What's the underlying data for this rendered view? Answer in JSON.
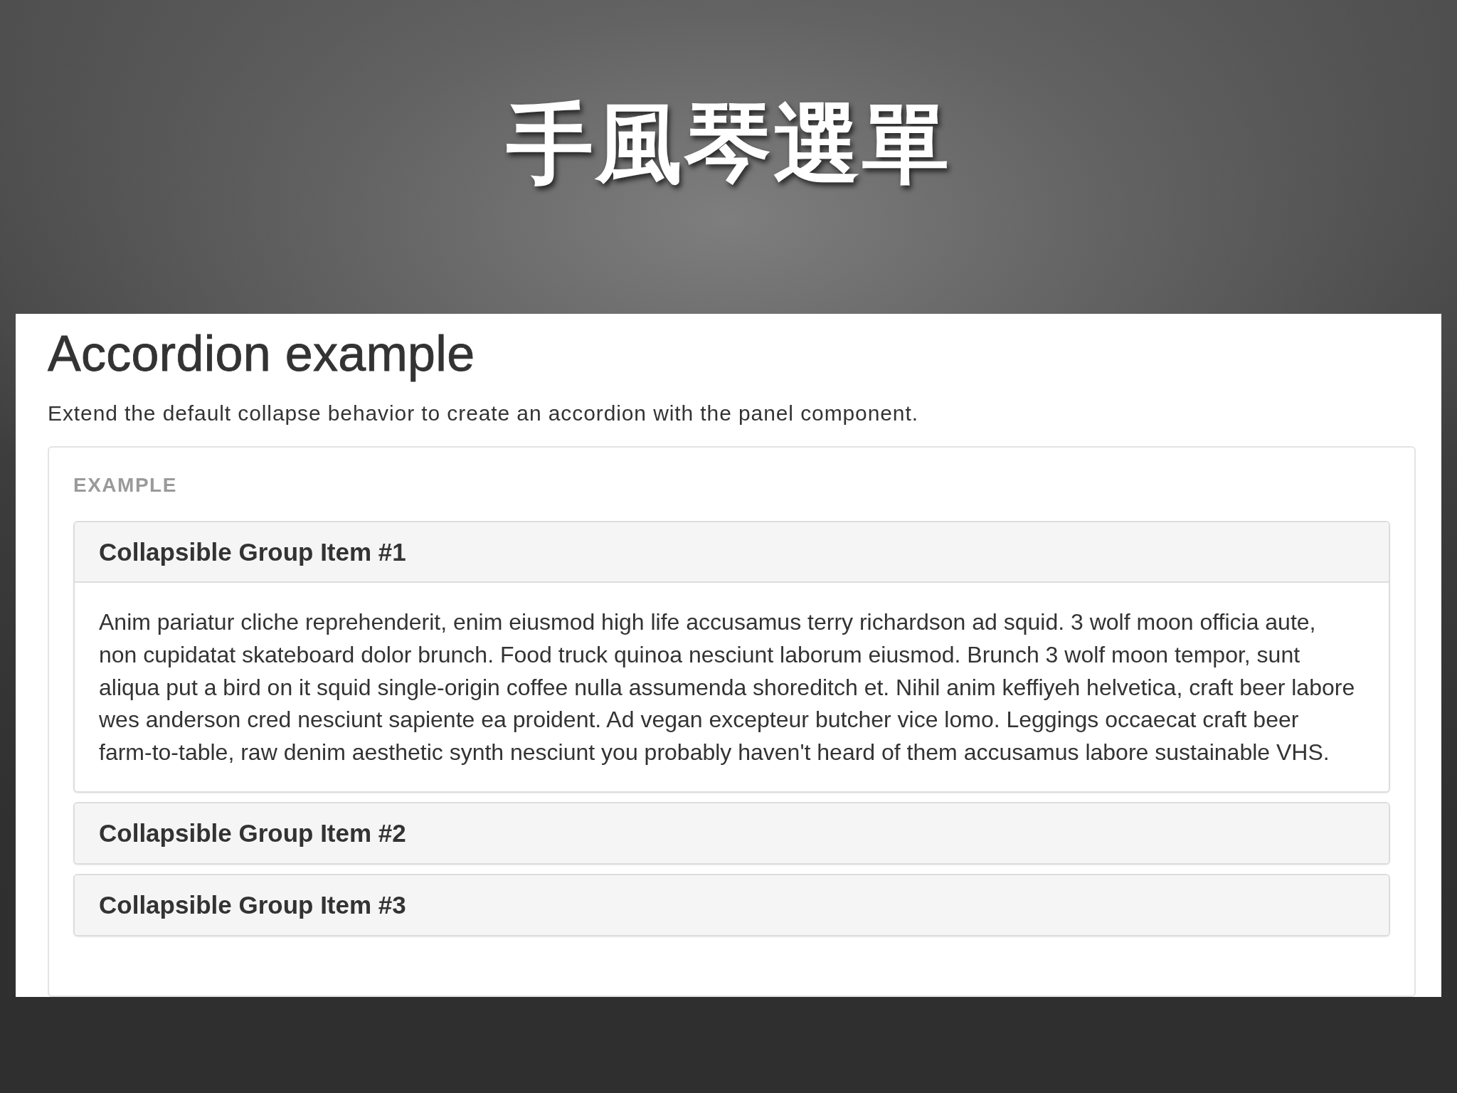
{
  "slide_title": "手風琴選單",
  "screenshot": {
    "heading": "Accordion example",
    "description": "Extend the default collapse behavior to create an accordion with the panel component.",
    "example": {
      "label": "EXAMPLE",
      "panels": [
        {
          "title": "Collapsible Group Item #1",
          "expanded": true,
          "body": "Anim pariatur cliche reprehenderit, enim eiusmod high life accusamus terry richardson ad squid. 3 wolf moon officia aute, non cupidatat skateboard dolor brunch. Food truck quinoa nesciunt laborum eiusmod. Brunch 3 wolf moon tempor, sunt aliqua put a bird on it squid single-origin coffee nulla assumenda shoreditch et. Nihil anim keffiyeh helvetica, craft beer labore wes anderson cred nesciunt sapiente ea proident. Ad vegan excepteur butcher vice lomo. Leggings occaecat craft beer farm-to-table, raw denim aesthetic synth nesciunt you probably haven't heard of them accusamus labore sustainable VHS."
        },
        {
          "title": "Collapsible Group Item #2",
          "expanded": false
        },
        {
          "title": "Collapsible Group Item #3",
          "expanded": false
        }
      ]
    }
  }
}
